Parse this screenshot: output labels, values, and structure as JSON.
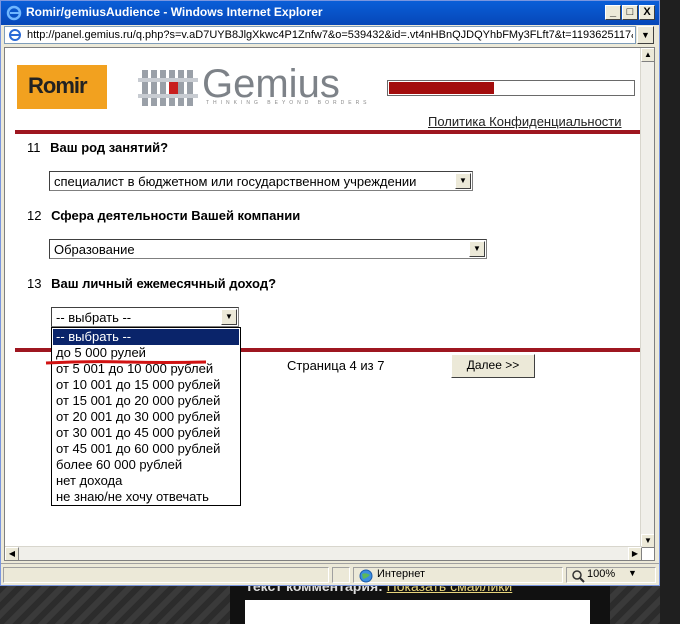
{
  "window": {
    "title": "Romir/gemiusAudience - Windows Internet Explorer",
    "address": "http://panel.gemius.ru/q.php?s=v.aD7UYB8JlgXkwc4P1Znfw7&o=539432&id=.vt4nHBnQJDQYhbFMy3FLft7&t=1193625117&r",
    "minimize_label": "_",
    "maximize_label": "□",
    "close_label": "X"
  },
  "header": {
    "romir_logo_text": "Romir",
    "gemius_logo_text": "Gemius",
    "gemius_tagline": "THINKING BEYOND BORDERS",
    "privacy_link": "Политика Конфиденциальности",
    "progress_fraction": 0.43
  },
  "questions": [
    {
      "number": "11",
      "text": "Ваш род занятий?",
      "selected": "специалист в бюджетном или государственном учреждении"
    },
    {
      "number": "12",
      "text": "Сфера деятельности Вашей компании",
      "selected": "Образование"
    },
    {
      "number": "13",
      "text": "Ваш личный ежемесячный доход?",
      "selected": "-- выбрать --"
    }
  ],
  "income_options": [
    "-- выбрать --",
    "до 5 000 рулей",
    "от 5 001 до 10 000 рублей",
    "от 10 001 до 15 000 рублей",
    "от 15 001 до 20 000 рублей",
    "от 20 001 до 30 000 рублей",
    "от 30 001 до 45 000 рублей",
    "от 45 001 до 60 000 рублей",
    "более 60 000 рублей",
    "нет дохода",
    "не знаю/не хочу отвечать"
  ],
  "footer": {
    "page_indicator": "Страница 4 из 7",
    "next_button": "Далее >>"
  },
  "statusbar": {
    "zone": "Интернет",
    "zoom": "100%"
  },
  "background": {
    "comments_text": "Текст комментария:",
    "comments_link": "Показать смайлики"
  },
  "colors": {
    "accent_red": "#9e1620",
    "progress_fill": "#a30d0d",
    "romir_orange": "#f2a11f",
    "selection_blue": "#0a246a",
    "titlebar_blue": "#0a5fd8"
  }
}
